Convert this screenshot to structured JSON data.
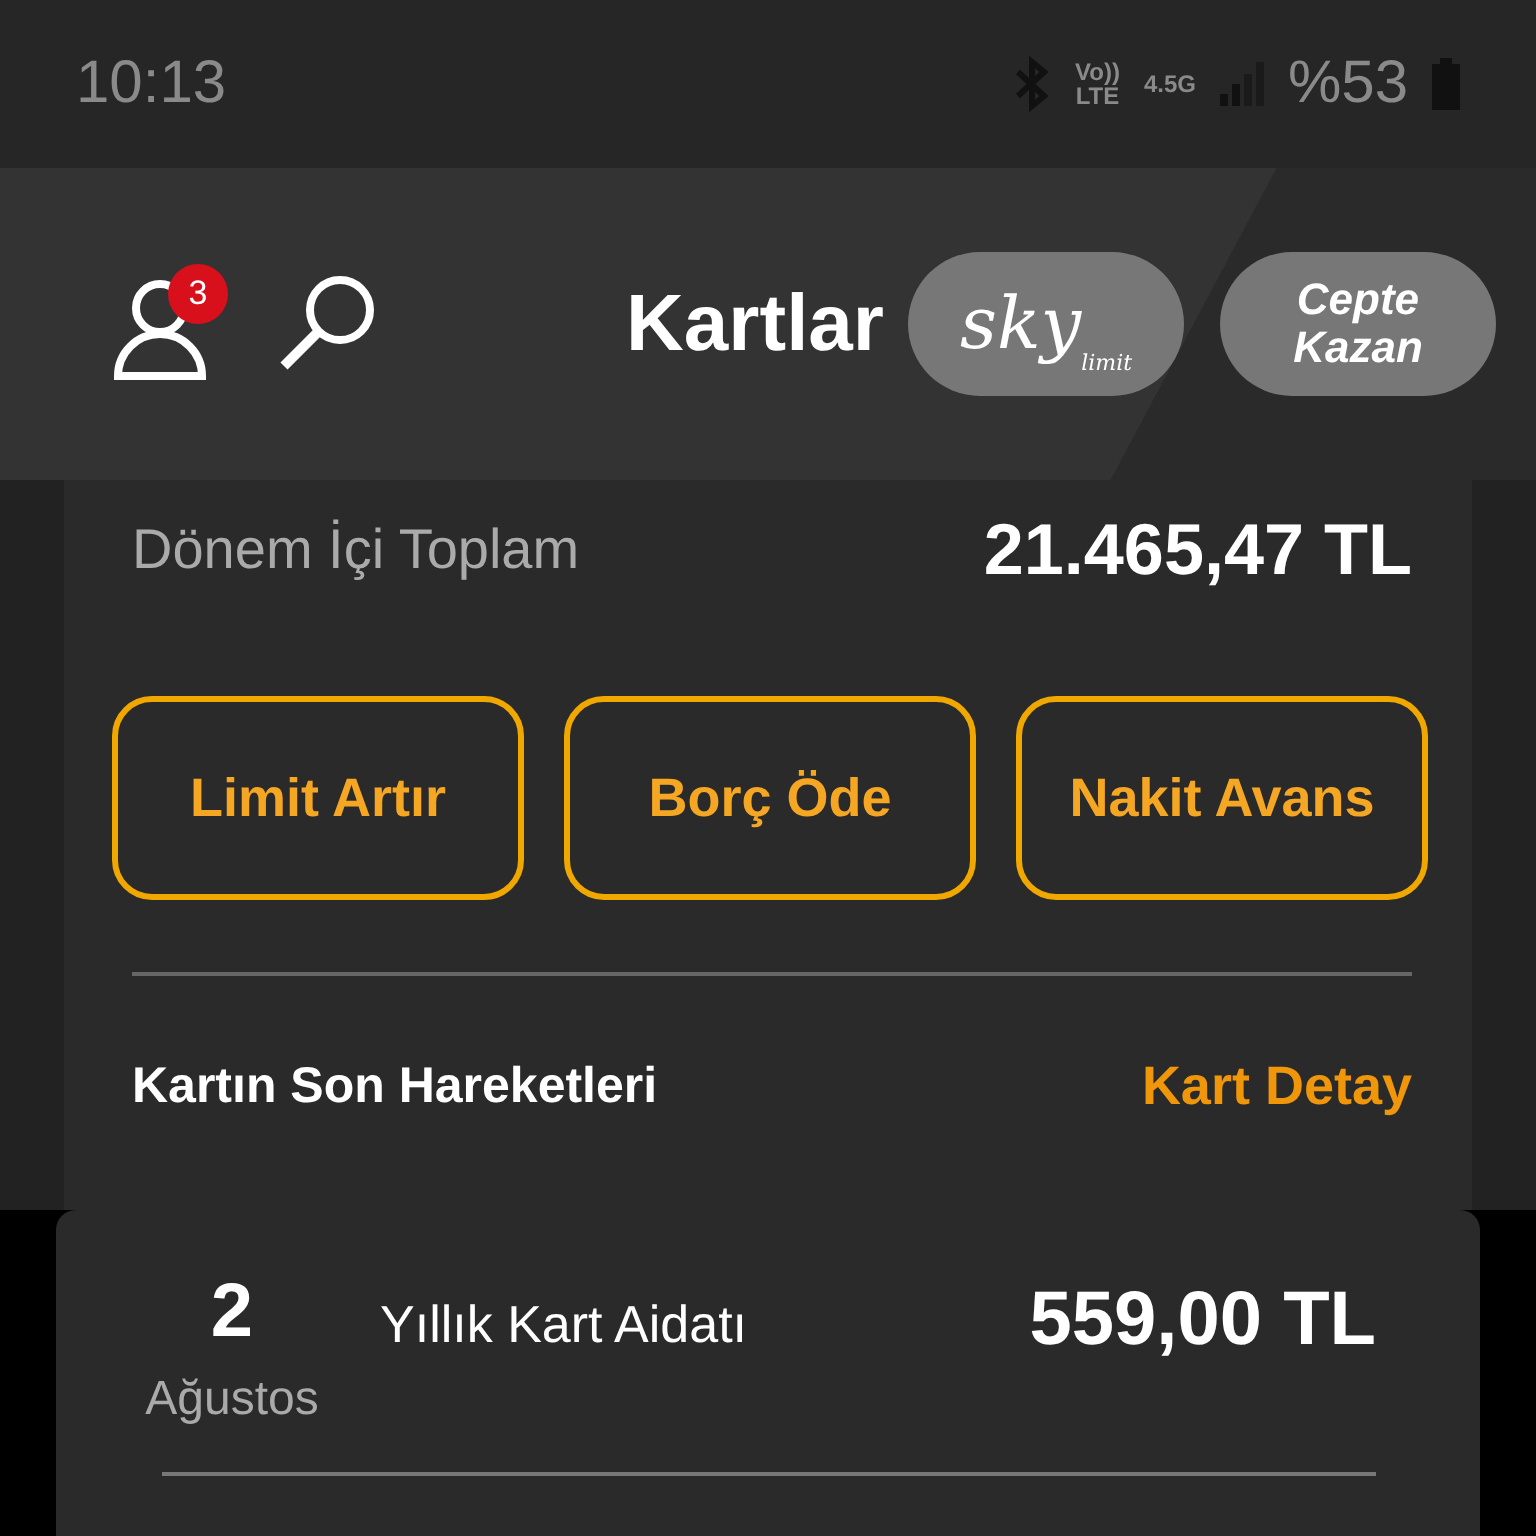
{
  "status_bar": {
    "time": "10:13",
    "network": "Vo))\nLTE",
    "data": "4.5G",
    "battery": "%53"
  },
  "header": {
    "notifications": "3",
    "title": "Kartlar",
    "logo": {
      "script": "sky",
      "sub": "limit"
    },
    "promo": "Cepte\nKazan"
  },
  "summary": {
    "label": "Dönem İçi Toplam",
    "amount": "21.465,47 TL"
  },
  "actions": [
    "Limit Artır",
    "Borç Öde",
    "Nakit Avans"
  ],
  "movements": {
    "title": "Kartın Son Hareketleri",
    "link": "Kart Detay",
    "items": [
      {
        "day": "2",
        "month": "Ağustos",
        "description": "Yıllık Kart Aidatı",
        "amount": "559,00 TL"
      }
    ]
  }
}
